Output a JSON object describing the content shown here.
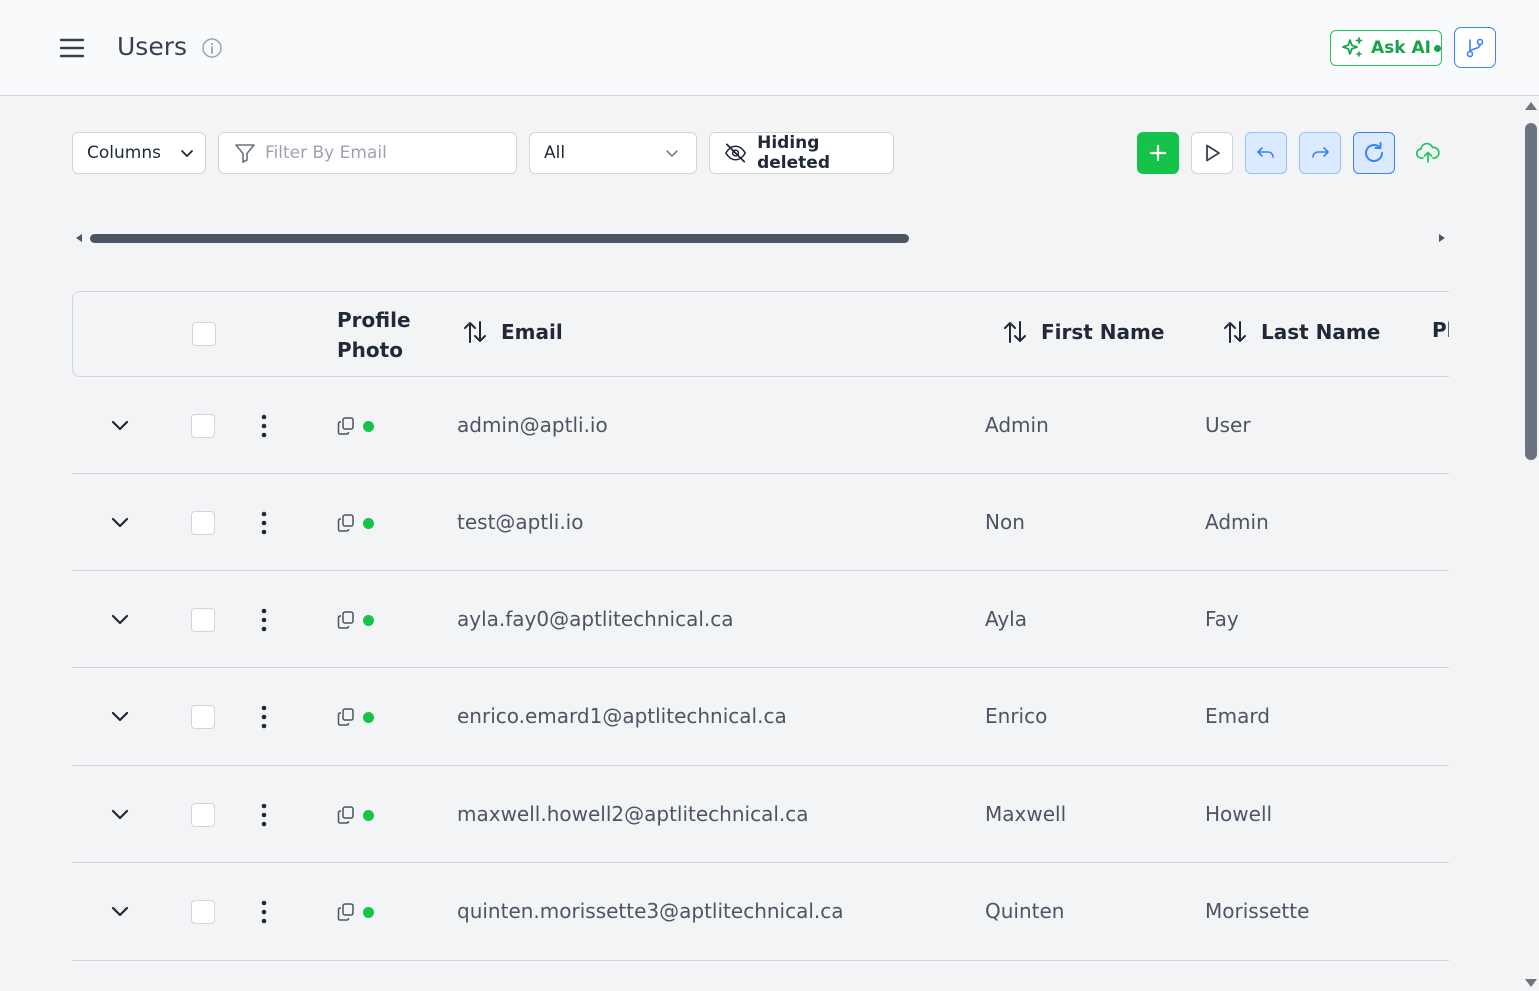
{
  "header": {
    "title": "Users",
    "ask_ai_label": "Ask AI"
  },
  "toolbar": {
    "columns_label": "Columns",
    "filter_placeholder": "Filter By Email",
    "filter_value": "",
    "status_select": "All",
    "hiding_label": "Hiding deleted"
  },
  "table": {
    "headers": {
      "photo": "Profile Photo",
      "email": "Email",
      "first_name": "First Name",
      "last_name": "Last Name",
      "truncated": "Ph"
    },
    "rows": [
      {
        "email": "admin@aptli.io",
        "first_name": "Admin",
        "last_name": "User"
      },
      {
        "email": "test@aptli.io",
        "first_name": "Non",
        "last_name": "Admin"
      },
      {
        "email": "ayla.fay0@aptlitechnical.ca",
        "first_name": "Ayla",
        "last_name": "Fay"
      },
      {
        "email": "enrico.emard1@aptlitechnical.ca",
        "first_name": "Enrico",
        "last_name": "Emard"
      },
      {
        "email": "maxwell.howell2@aptlitechnical.ca",
        "first_name": "Maxwell",
        "last_name": "Howell"
      },
      {
        "email": "quinten.morissette3@aptlitechnical.ca",
        "first_name": "Quinten",
        "last_name": "Morissette"
      }
    ]
  },
  "colors": {
    "accent_green": "#16c34a",
    "accent_blue": "#3b82f6",
    "status_active": "#16c34a"
  }
}
